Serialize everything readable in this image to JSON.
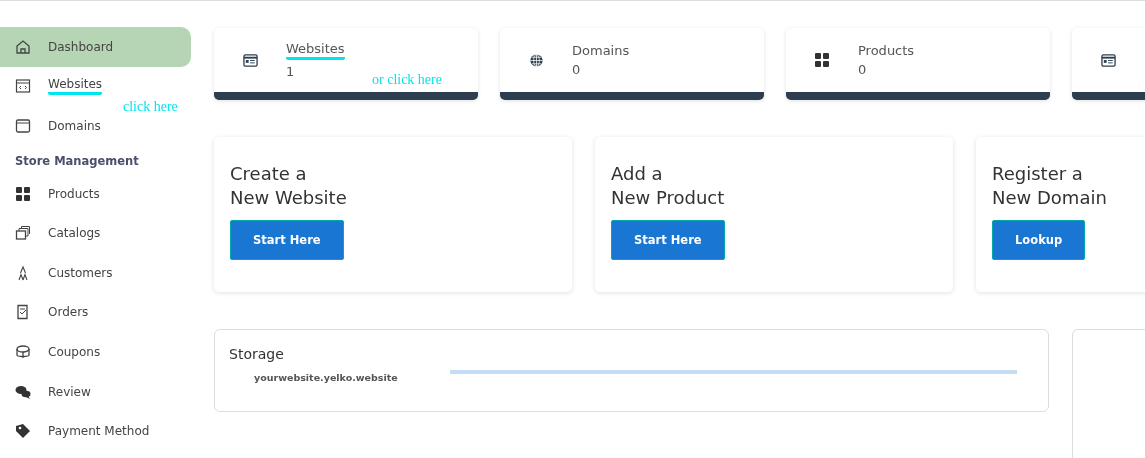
{
  "sidebar": {
    "items": [
      {
        "kind": "item",
        "label": "Dashboard",
        "selected": true,
        "underlined": false
      },
      {
        "kind": "item",
        "label": "Websites",
        "selected": false,
        "underlined": true
      },
      {
        "kind": "item",
        "label": "Domains",
        "selected": false,
        "underlined": false
      },
      {
        "kind": "heading",
        "label": "Store Management"
      },
      {
        "kind": "item",
        "label": "Products",
        "selected": false,
        "underlined": false
      },
      {
        "kind": "item",
        "label": "Catalogs",
        "selected": false,
        "underlined": false
      },
      {
        "kind": "item",
        "label": "Customers",
        "selected": false,
        "underlined": false
      },
      {
        "kind": "item",
        "label": "Orders",
        "selected": false,
        "underlined": false
      },
      {
        "kind": "item",
        "label": "Coupons",
        "selected": false,
        "underlined": false
      },
      {
        "kind": "item",
        "label": "Review",
        "selected": false,
        "underlined": false
      },
      {
        "kind": "item",
        "label": "Payment Method",
        "selected": false,
        "underlined": false
      }
    ],
    "annotation": "click here"
  },
  "stats": [
    {
      "label": "Websites",
      "value": "1",
      "underlined": true,
      "annotation": "or click here"
    },
    {
      "label": "Domains",
      "value": "0",
      "underlined": false
    },
    {
      "label": "Products",
      "value": "0",
      "underlined": false
    }
  ],
  "actions": [
    {
      "title": "Create a\nNew Website",
      "button": "Start Here"
    },
    {
      "title": "Add a\nNew Product",
      "button": "Start Here"
    },
    {
      "title": "Register a\nNew Domain",
      "button": "Lookup"
    }
  ],
  "storage": {
    "title": "Storage",
    "site": "yourwebsite.yelko.website"
  }
}
